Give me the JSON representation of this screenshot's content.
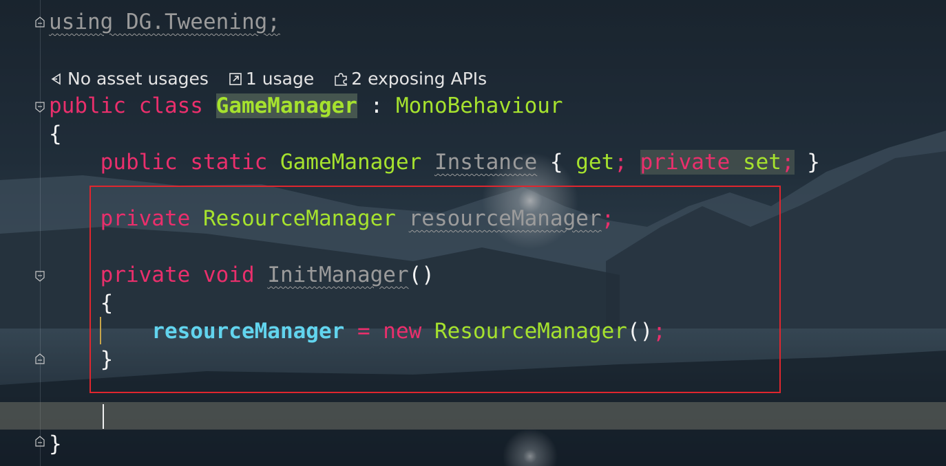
{
  "editor": {
    "lines": {
      "using": "using DG.Tweening;",
      "class_kw_public": "public",
      "class_kw_class": "class",
      "class_name": "GameManager",
      "class_colon": " : ",
      "class_base": "MonoBehaviour",
      "open_brace": "{",
      "prop_public": "public",
      "prop_static": "static",
      "prop_type": "GameManager",
      "prop_name": "Instance",
      "prop_open": " { ",
      "prop_get": "get",
      "prop_semi1": ";",
      "prop_private": "private",
      "prop_set": "set",
      "prop_semi2": ";",
      "prop_close": " }",
      "field_private": "private",
      "field_type": "ResourceManager",
      "field_name": "resourceManager",
      "field_semi": ";",
      "method_private": "private",
      "method_void": "void",
      "method_name": "InitManager",
      "method_parens": "()",
      "method_open": "{",
      "assign_target": "resourceManager",
      "assign_eq": " = ",
      "assign_new": "new",
      "assign_type": "ResourceManager",
      "assign_parens": "()",
      "assign_semi": ";",
      "method_close": "}",
      "class_close": "}"
    },
    "hints": {
      "asset_usages": "No asset usages",
      "usages": "1 usage",
      "exposing_apis": "2 exposing APIs"
    },
    "colors": {
      "keyword": "#ea2f6c",
      "type": "#a6e22e",
      "field": "#62d4ee",
      "highlight_box": "#e0262e"
    }
  }
}
